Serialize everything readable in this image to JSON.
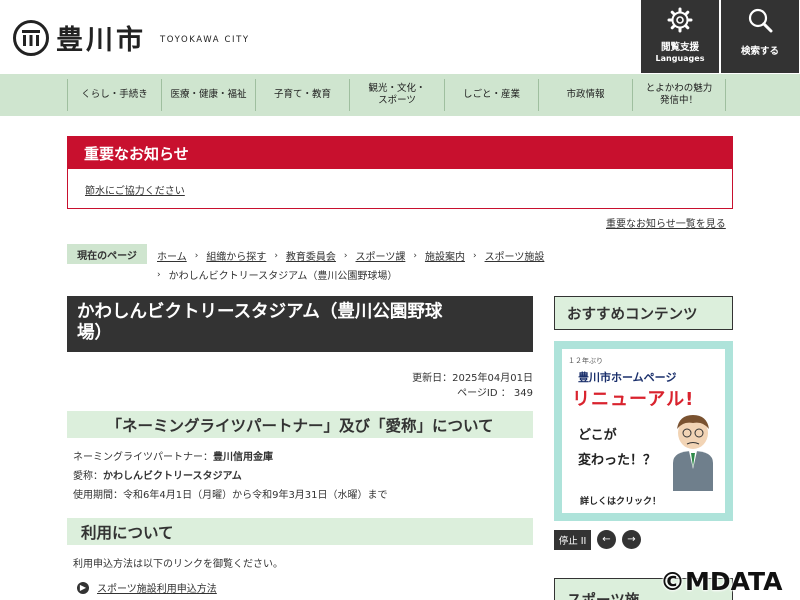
{
  "header": {
    "logo_text": "豊川市",
    "logo_sub": "TOYOKAWA CITY",
    "lang_button": {
      "line1": "閲覧支援",
      "line2": "Languages"
    },
    "search_button": {
      "label": "検索する"
    }
  },
  "nav": {
    "items": [
      {
        "line1": "くらし・手続き",
        "line2": ""
      },
      {
        "line1": "医療・健康・福祉",
        "line2": ""
      },
      {
        "line1": "子育て・教育",
        "line2": ""
      },
      {
        "line1": "観光・文化・",
        "line2": "スポーツ"
      },
      {
        "line1": "しごと・産業",
        "line2": ""
      },
      {
        "line1": "市政情報",
        "line2": ""
      },
      {
        "line1": "とよかわの魅力",
        "line2": "発信中！"
      }
    ]
  },
  "notice": {
    "title": "重要なお知らせ",
    "link": "節水にご協力ください",
    "all_link": "重要なお知らせ一覧を見る"
  },
  "breadcrumb": {
    "label": "現在のページ",
    "items": [
      "ホーム",
      "組織から探す",
      "教育委員会",
      "スポーツ課",
      "施設案内",
      "スポーツ施設"
    ],
    "current": "かわしんビクトリースタジアム（豊川公園野球場）"
  },
  "main": {
    "title_line1": "かわしんビクトリースタジアム（豊川公園野球",
    "title_line2": "場）",
    "updated": "更新日：2025年04月01日",
    "page_id": "ページID ： 349",
    "section1": {
      "heading": "「ネーミングライツパートナー」及び「愛称」について",
      "partner_label": "ネーミングライツパートナー：",
      "partner_value": "豊川信用金庫",
      "nickname_label": "愛称：",
      "nickname_value": "かわしんビクトリースタジアム",
      "period": "使用期間：令和6年4月1日（月曜）から令和9年3月31日（水曜）まで"
    },
    "section2": {
      "heading": "利用について",
      "text": "利用申込方法は以下のリンクを御覧ください。",
      "link": "スポーツ施設利用申込方法"
    }
  },
  "side": {
    "heading": "おすすめコンテンツ",
    "banner": {
      "badge": "１２年ぶり",
      "line1": "豊川市ホームページ",
      "line2": "リニューアル!",
      "line3": "どこが",
      "line4": "変わった！？",
      "line5": "詳しくはクリック！"
    },
    "stop_label": "停止 II",
    "prev_label": "←",
    "next_label": "→",
    "heading2": "スポーツ施"
  },
  "watermark": "©MDATA"
}
